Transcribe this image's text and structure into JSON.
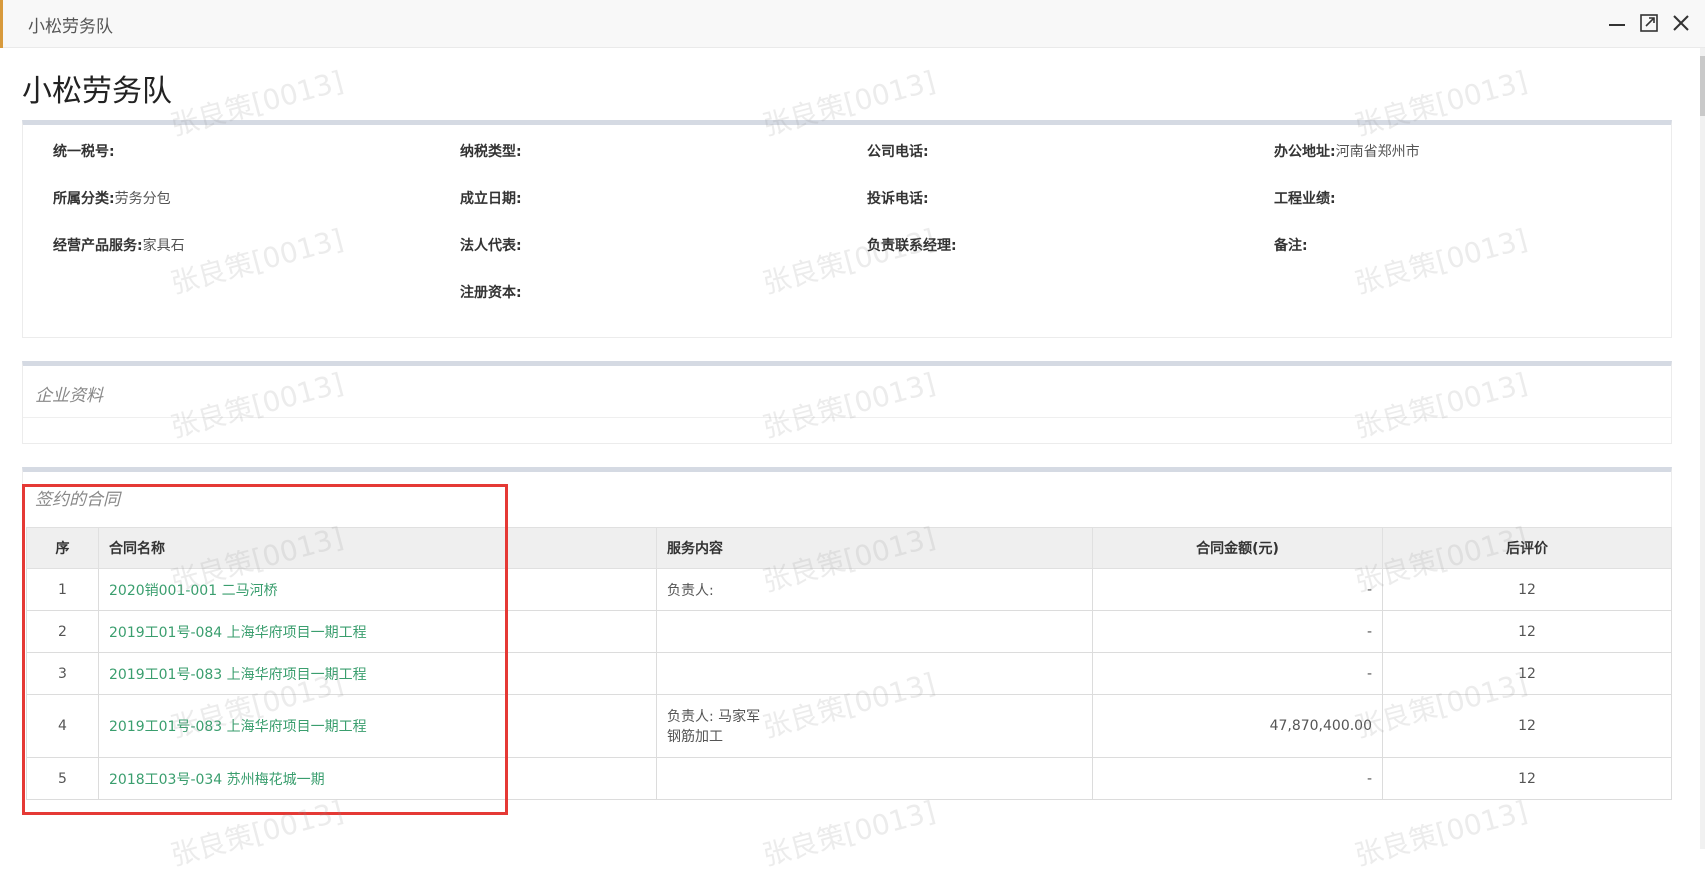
{
  "window": {
    "title": "小松劳务队"
  },
  "page": {
    "title": "小松劳务队"
  },
  "info": {
    "col1": [
      {
        "label": "统一税号:",
        "value": ""
      },
      {
        "label": "所属分类:",
        "value": "劳务分包"
      },
      {
        "label": "经营产品服务:",
        "value": "家具石"
      }
    ],
    "col2": [
      {
        "label": "纳税类型:",
        "value": ""
      },
      {
        "label": "成立日期:",
        "value": ""
      },
      {
        "label": "法人代表:",
        "value": ""
      },
      {
        "label": "注册资本:",
        "value": ""
      }
    ],
    "col3": [
      {
        "label": "公司电话:",
        "value": ""
      },
      {
        "label": "投诉电话:",
        "value": ""
      },
      {
        "label": "负责联系经理:",
        "value": ""
      }
    ],
    "col4": [
      {
        "label": "办公地址:",
        "value": "河南省郑州市"
      },
      {
        "label": "工程业绩:",
        "value": ""
      },
      {
        "label": "备注:",
        "value": ""
      }
    ]
  },
  "docs": {
    "title": "企业资料"
  },
  "contracts": {
    "title": "签约的合同",
    "headers": [
      "序",
      "合同名称",
      "服务内容",
      "合同金额(元)",
      "后评价"
    ],
    "rows": [
      {
        "idx": "1",
        "name": "2020销001-001 二马河桥",
        "service": [
          "负责人:"
        ],
        "amount": "-",
        "eval": "12"
      },
      {
        "idx": "2",
        "name": "2019工01号-084 上海华府项目一期工程",
        "service": [],
        "amount": "-",
        "eval": "12"
      },
      {
        "idx": "3",
        "name": "2019工01号-083 上海华府项目一期工程",
        "service": [],
        "amount": "-",
        "eval": "12"
      },
      {
        "idx": "4",
        "name": "2019工01号-083 上海华府项目一期工程",
        "service": [
          "负责人: 马家军",
          "钢筋加工"
        ],
        "amount": "47,870,400.00",
        "eval": "12"
      },
      {
        "idx": "5",
        "name": "2018工03号-034 苏州梅花城一期",
        "service": [],
        "amount": "-",
        "eval": "12"
      }
    ]
  },
  "watermark": "张良策[0013]",
  "colors": {
    "link": "#3a9e6e",
    "highlight": "#e53935",
    "panel_top": "#d5dae3",
    "accent": "#d89a3c"
  },
  "icons": [
    "minimize-icon",
    "maximize-icon",
    "close-icon"
  ]
}
